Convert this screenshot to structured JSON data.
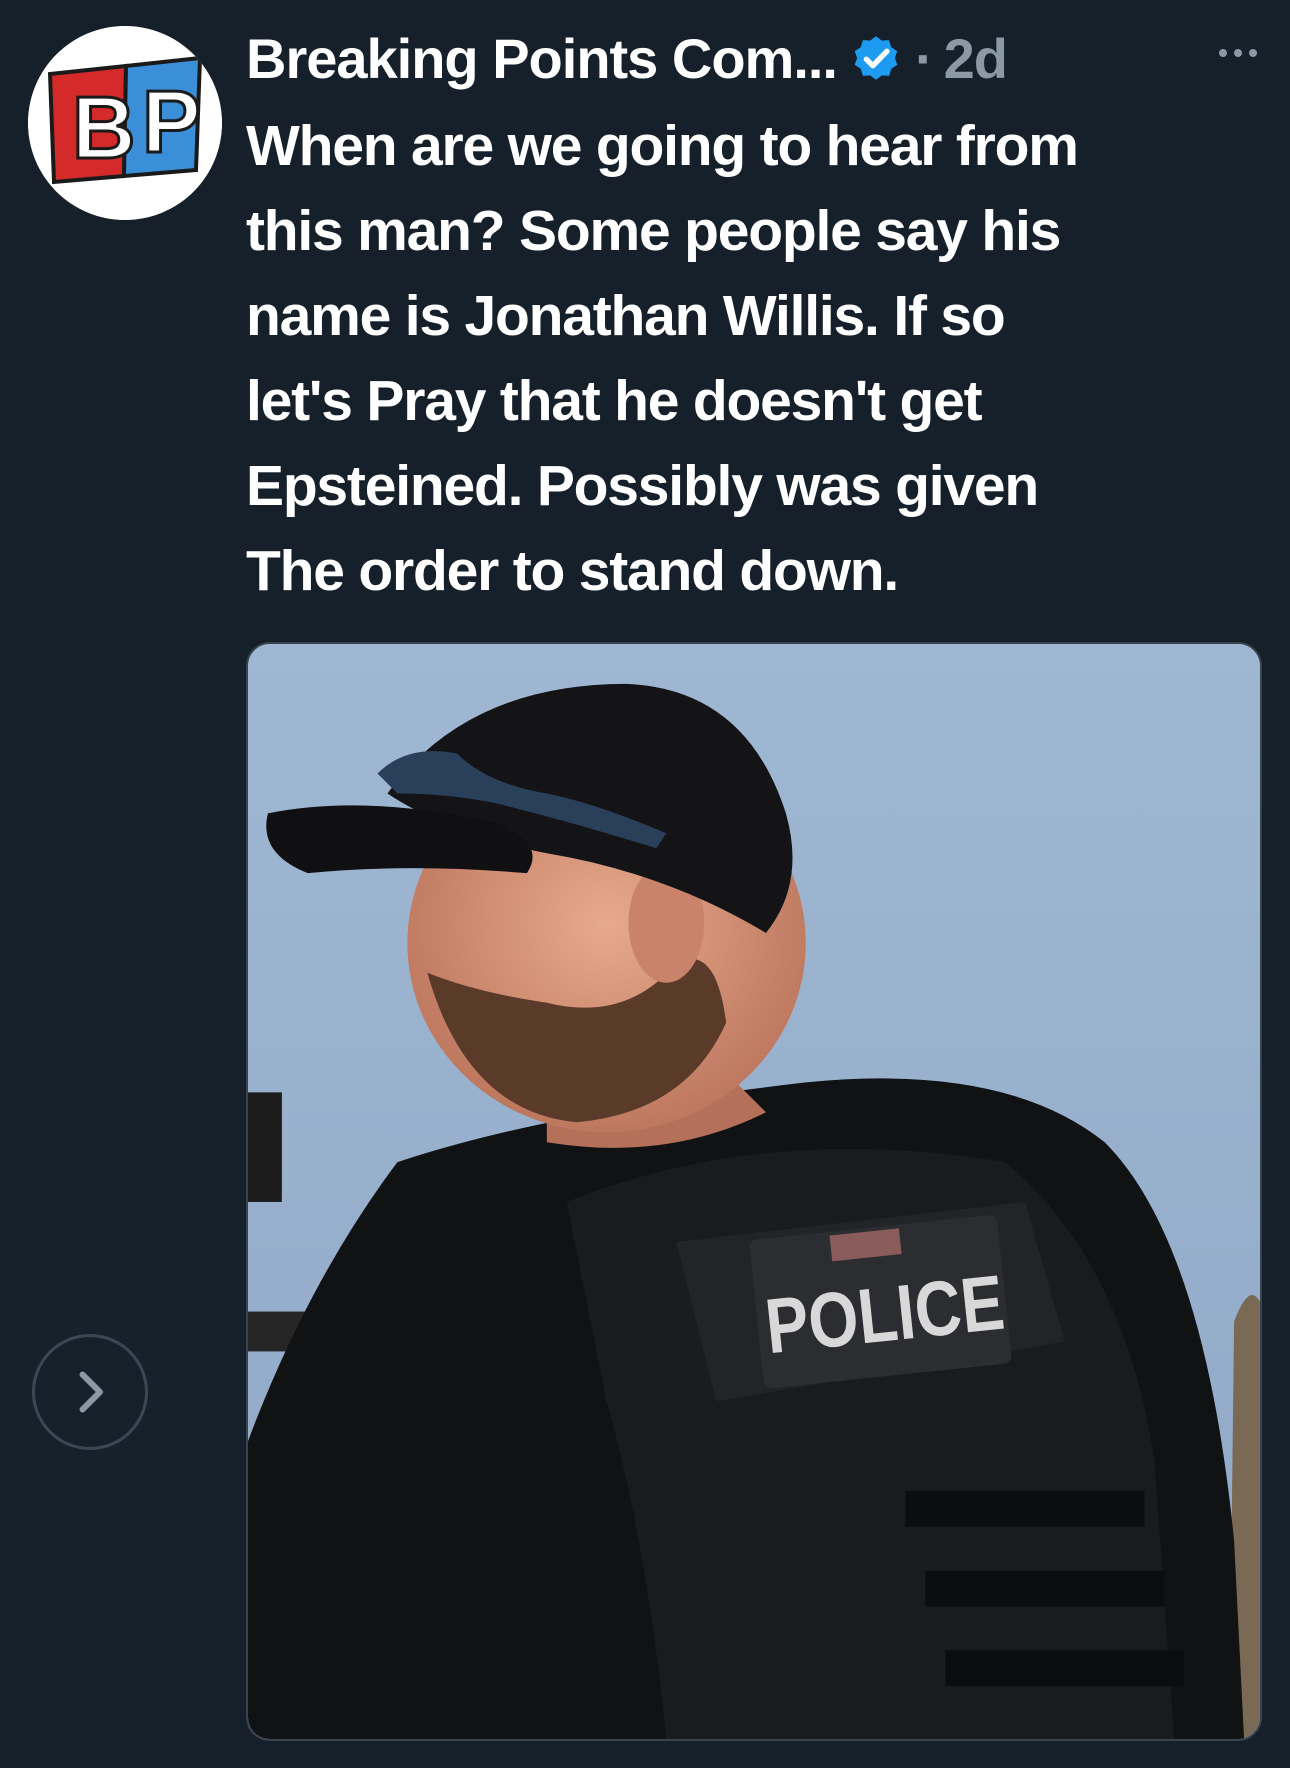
{
  "tweet": {
    "author": {
      "display_name": "Breaking Points Com...",
      "avatar_text": "BP",
      "verified": true
    },
    "separator": "·",
    "time": "2d",
    "more_icon": "more-horizontal-icon",
    "text": "When are we going to hear from\nthis man? Some people say his\nname is Jonathan Willis. If so\nlet's Pray that he doesn't get\nEpsteined. Possibly was given\nThe order to stand down.",
    "media": {
      "vest_label": "POLICE"
    },
    "carousel": {
      "next_icon": "chevron-right-icon"
    }
  },
  "colors": {
    "background": "#15202b",
    "text_primary": "#ffffff",
    "text_secondary": "#8b98a5",
    "verified_badge": "#1d9bf0",
    "avatar_red": "#d42a2a",
    "avatar_blue": "#3b8fd9"
  }
}
